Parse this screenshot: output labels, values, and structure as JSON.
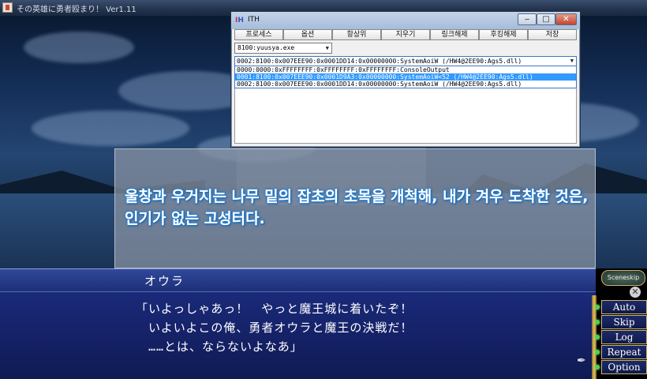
{
  "game": {
    "window_title": "その英雄に勇者殴まり！ Ver1.11",
    "narration": "울창과 우거지는 나무 밑의 잡초의 초목을 개척해, 내가 겨우 도착한 것은, 인기가 없는 고성터다.",
    "speaker": "オウラ",
    "dialogue": [
      "「いよっしゃあっ！　やっと魔王城に着いたぞ！",
      "いよいよこの俺、勇者オウラと魔王の決戦だ！",
      "……とは、ならないよなあ」"
    ],
    "scene_skip": "Sceneskip",
    "menu": [
      "Auto",
      "Skip",
      "Log",
      "Repeat",
      "Option"
    ]
  },
  "ith": {
    "title": "ITH",
    "toolbar": [
      "프로세스",
      "옵션",
      "항상위",
      "지우기",
      "링크해제",
      "후킹해제",
      "저장"
    ],
    "process": "8100:yuusya.exe",
    "thread_selected": "0002:8100:0x007EEE90:0x0001DD14:0x00000000:SystemAoiW (/HW4@2EE90:Ags5.dll)",
    "threads": [
      "0000:0000:0xFFFFFFFF:0xFFFFFFFF:0xFFFFFFFF:ConsoleOutput",
      "0001:8100:0x007EEE90:0x0001D9A3:0x00000000:SystemAoiW<52 (/HW4@2EE90:Ags5.dll)",
      "0002:8100:0x007EEE90:0x0001DD14:0x00000000:SystemAoiW (/HW4@2EE90:Ags5.dll)"
    ],
    "selected_index": 1
  }
}
